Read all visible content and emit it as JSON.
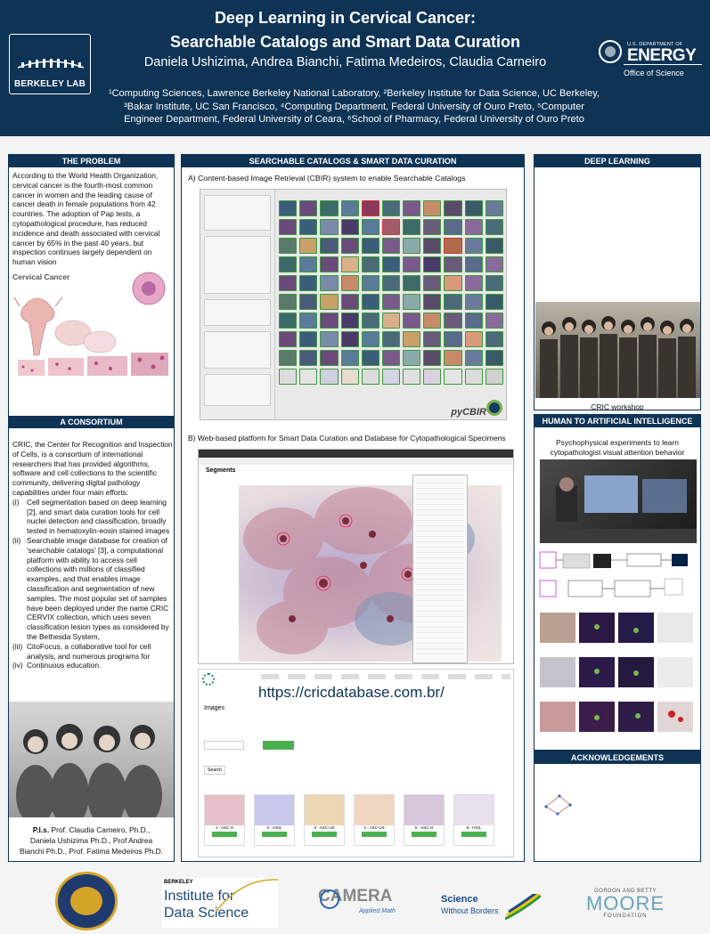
{
  "header": {
    "title_line1": "Deep Learning in Cervical Cancer:",
    "title_line2": "Searchable Catalogs and Smart Data Curation",
    "authors": "Daniela Ushizima, Andrea Bianchi, Fatima Medeiros, Claudia Carneiro",
    "affiliation_line1": "¹Computing Sciences, Lawrence Berkeley National Laboratory, ²Berkeley Institute for Data Science, UC Berkeley,",
    "affiliation_line2": "³Bakar Institute, UC San Francisco, ⁴Computing Department, Federal University of Ouro Preto, ⁵Computer",
    "affiliation_line3": "Engineer Department, Federal University of Ceara, ⁶School of Pharmacy, Federal University of Ouro Preto",
    "logo_left_text": "BERKELEY LAB",
    "logo_right_small": "U.S. DEPARTMENT OF",
    "logo_right_big": "ENERGY",
    "logo_right_sub": "Office of Science"
  },
  "problem": {
    "heading": "THE PROBLEM",
    "text": "According to the World Health Organization, cervical cancer is the fourth-most common cancer in women and the leading cause of cancer death in female populations from 42 countries. The adoption of Pap tests, a cytopathological procedure, has reduced incidence and death associated with cervical cancer by 65% in the past 40 years, but inspection continues largely dependent on human vision",
    "figure_title": "Cervical Cancer"
  },
  "consortium": {
    "heading": "A CONSORTIUM",
    "intro": "CRIC, the Center for Recognition and Inspection of Cells, is a consortium of international researchers that has provided algorithms, software and cell collections to the scientific community, delivering digital pathology capabilities under four main efforts:",
    "items": [
      {
        "num": "(i)",
        "text": "Cell segmentation based on deep learning [2], and smart data curation tools for cell nuclei detection and classification, broadly tested in hematoxylin-eosin stained images"
      },
      {
        "num": "(ii)",
        "text": "Searchable image database for creation of 'searchable catalogs' [3], a computational platform with ability to access cell collections with millions of classified examples, and that enables image classification and segmentation of new samples. The most popular set of samples have been deployed under the name CRIC CERVIX collection, which uses seven classification lesion types as considered by the Bethesda System,"
      },
      {
        "num": "(iii)",
        "text": "CitoFocus, a collaborative tool for cell analysis, and numerous programs for"
      },
      {
        "num": "(iv)",
        "text": "Continuous education."
      }
    ],
    "pis_label": "P.I.s.",
    "pis_line1": " Prof. Claudia Carneiro, Ph.D.,",
    "pis_line2": "Daniela Ushizima Ph.D., Prof Andrea",
    "pis_line3": "Bianchi Ph.D., Prof. Fatima Medeiros Ph.D."
  },
  "catalogs": {
    "heading": "SEARCHABLE CATALOGS & SMART DATA CURATION",
    "subA": "A) Content-based Image Retrieval (CBIR) system to enable Searchable Catalogs",
    "subB": "B) Web-based platform for Smart Data Curation and Database for Cytopathological Specimens",
    "url": "https://cricdatabase.com.br/",
    "pycbir": "pyCBIR",
    "segments_title": "Segments",
    "images_title": "Images",
    "search_btn": "Search",
    "thumbs": [
      "1 - ASC-H",
      "2 - HSIL",
      "3 - ASC-US",
      "4 - ASC-US",
      "5 - ASC-H",
      "6 - HSIL"
    ]
  },
  "deep": {
    "heading": "DEEP LEARNING",
    "workshop_caption": "CRIC workshop",
    "h2": "HUMAN TO ARTIFICIAL INTELLIGENCE",
    "psycho_caption": "Psychophysical experiments to learn cytopathologist visual attention behavior",
    "ack_heading": "ACKNOWLEDGEMENTS"
  },
  "footer": {
    "bids_line1": "BERKELEY",
    "bids_line2": "Institute for",
    "bids_line3": "Data Science",
    "camera_text": "CAMERA",
    "camera_sub": "Applied Math",
    "swb_line1": "Science",
    "swb_line2": "Without Borders",
    "moore_line1": "GORDON AND BETTY",
    "moore_line2": "MOORE",
    "moore_line3": "FOUNDATION"
  }
}
